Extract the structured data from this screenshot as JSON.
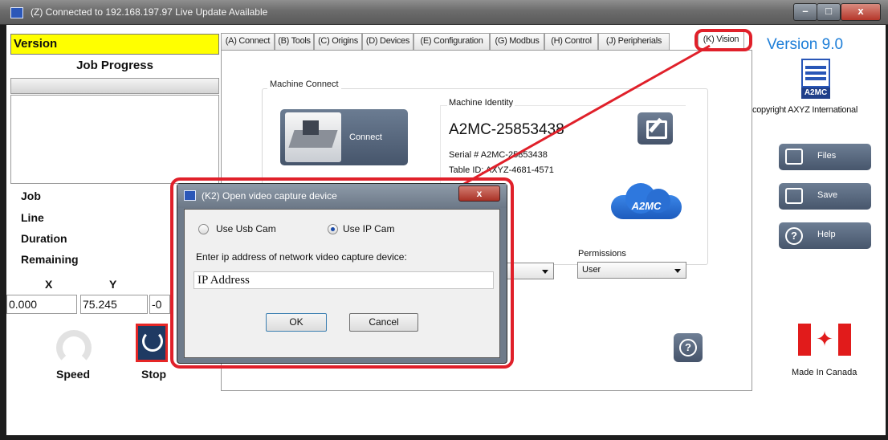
{
  "window": {
    "title": "(Z) Connected to 192.168.197.97 Live Update Available",
    "minimize": "–",
    "maximize": "□",
    "close": "x"
  },
  "left_panel": {
    "version_label": "Version",
    "job_progress": "Job Progress",
    "info_labels": [
      "Job",
      "Line",
      "Duration",
      "Remaining"
    ],
    "x_label": "X",
    "y_label": "Y",
    "x_value": "0.000",
    "y_value": "75.245",
    "z_value_partial": "-0",
    "speed_label": "Speed",
    "stop_label": "Stop"
  },
  "tabs": [
    {
      "label": "(A) Connect"
    },
    {
      "label": "(B) Tools"
    },
    {
      "label": "(C) Origins"
    },
    {
      "label": "(D) Devices"
    },
    {
      "label": "(E) Configuration"
    },
    {
      "label": "(G) Modbus"
    },
    {
      "label": "(H) Control"
    },
    {
      "label": "(J) Peripherials"
    },
    {
      "label": "(K) Vision"
    }
  ],
  "connect_page": {
    "machine_connect_label": "Machine Connect",
    "connect_button": "Connect",
    "machine_identity_label": "Machine Identity",
    "identity_name": "A2MC-25853438",
    "serial_line": "Serial #   A2MC-25853438",
    "table_id_line": "Table ID:  AXYZ-4681-4571",
    "partial_text": "3438",
    "cloud_logo_text": "A2MC",
    "permissions_label": "Permissions",
    "permissions_value": "User",
    "help_icon": "?"
  },
  "right_panel": {
    "version": "Version 9.0",
    "logo_tag": "A2MC",
    "copyright": "copyright AXYZ International",
    "files_button": "Files",
    "save_button": "Save",
    "help_button": "Help",
    "help_icon": "?",
    "made_in": "Made In Canada",
    "flag_leaf": "✦"
  },
  "dialog": {
    "title": "(K2) Open video capture device",
    "close": "x",
    "option_usb": "Use Usb Cam",
    "option_ip": "Use IP Cam",
    "selected_option": "Use IP Cam",
    "prompt": "Enter ip address of network video capture device:",
    "ip_value": "IP Address",
    "ok": "OK",
    "cancel": "Cancel"
  },
  "colors": {
    "version_bar": "#ffff00",
    "highlight_red": "#e0202a",
    "brand_blue": "#1d7ed8",
    "button_slate": "#5a6a80"
  }
}
